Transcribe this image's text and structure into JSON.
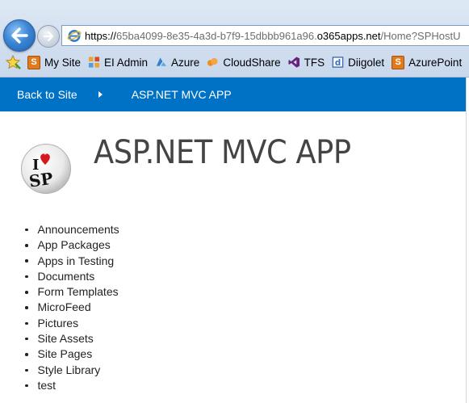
{
  "browser": {
    "address": {
      "scheme": "https://",
      "subdomain": "65ba4099-8e35-4a3d-b7f9-15dbbb961a96.",
      "domain": "o365apps.net",
      "path": "/Home?SPHostU"
    },
    "favorites": [
      {
        "label": "My Site",
        "icon": "sharepoint-icon"
      },
      {
        "label": "EI Admin",
        "icon": "admin-icon"
      },
      {
        "label": "Azure",
        "icon": "azure-icon"
      },
      {
        "label": "CloudShare",
        "icon": "cloudshare-icon"
      },
      {
        "label": "TFS",
        "icon": "visual-studio-icon"
      },
      {
        "label": "Diigolet",
        "icon": "diigo-icon"
      },
      {
        "label": "AzurePoint",
        "icon": "sharepoint-icon"
      }
    ]
  },
  "sp_bar": {
    "back_label": "Back to Site",
    "app_title": "ASP.NET MVC APP",
    "color": "#0072c6"
  },
  "page": {
    "title": "ASP.NET MVC APP",
    "logo_text_top": "I",
    "logo_text_bottom": "SP"
  },
  "libraries": [
    "Announcements",
    "App Packages",
    "Apps in Testing",
    "Documents",
    "Form Templates",
    "MicroFeed",
    "Pictures",
    "Site Assets",
    "Site Pages",
    "Style Library",
    "test"
  ]
}
